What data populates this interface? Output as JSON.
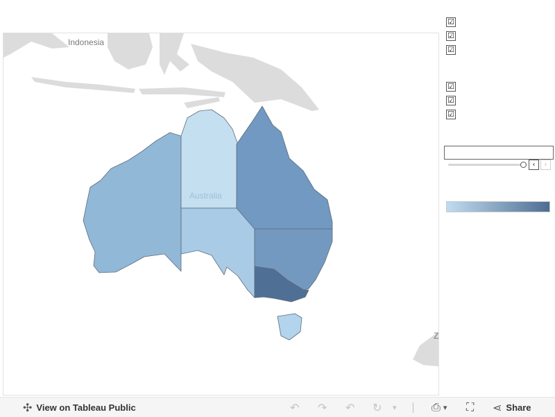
{
  "map": {
    "labels": {
      "indonesia": "Indonesia",
      "australia": "Australia",
      "cutoff_letter": "Z"
    },
    "colors": {
      "land": "#dcdcdc",
      "western_australia": "#92b8d7",
      "northern_territory": "#c4dff0",
      "south_australia": "#a9cbe5",
      "queensland": "#7199c1",
      "new_south_wales": "#7499c0",
      "victoria": "#4f6f95",
      "tasmania": "#b2d4ec"
    }
  },
  "filters": {
    "group1": [
      "☑",
      "☑",
      "☑"
    ],
    "group2": [
      "☑",
      "☑",
      "☑"
    ]
  },
  "search": {
    "value": "",
    "placeholder": ""
  },
  "stepper": {
    "prev": "‹",
    "next": "›"
  },
  "legend": {
    "start_color": "#c1dcef",
    "end_color": "#4e6d93"
  },
  "toolbar": {
    "view_label": "View on Tableau Public",
    "share_label": "Share",
    "icons": {
      "tableau": "✣",
      "undo": "↶",
      "redo": "↷",
      "revert": "↶",
      "refresh": "↻",
      "caret": "▾",
      "download": "⎙",
      "fullscreen": "⛶",
      "share": "⋖"
    }
  }
}
